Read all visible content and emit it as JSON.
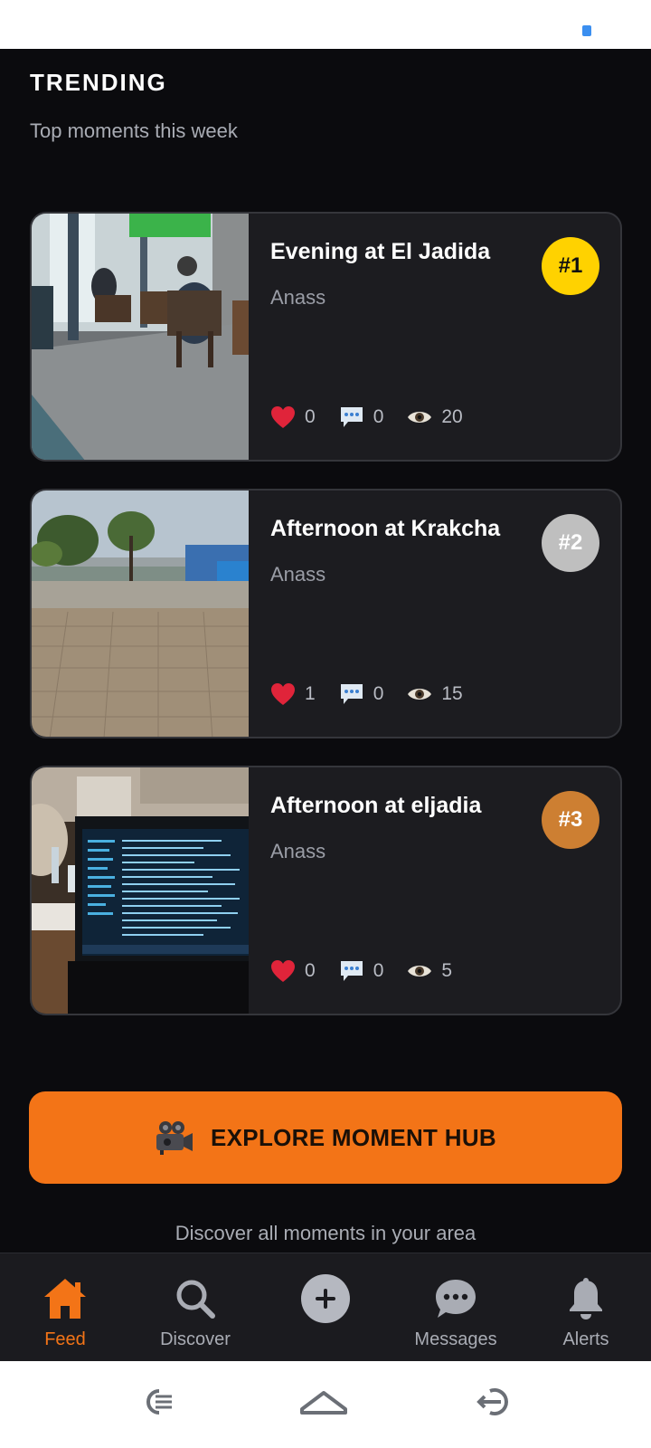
{
  "header": {
    "title": "TRENDING",
    "subtitle": "Top moments this week"
  },
  "moments": [
    {
      "title": "Evening at El Jadida",
      "author": "Anass",
      "rank": "#1",
      "rank_color": "#ffd200",
      "rank_text_color": "#111111",
      "likes": "0",
      "comments": "0",
      "views": "20"
    },
    {
      "title": "Afternoon at Krakcha",
      "author": "Anass",
      "rank": "#2",
      "rank_color": "#bfbfbf",
      "rank_text_color": "#ffffff",
      "likes": "1",
      "comments": "0",
      "views": "15"
    },
    {
      "title": "Afternoon at eljadia",
      "author": "Anass",
      "rank": "#3",
      "rank_color": "#cd7f32",
      "rank_text_color": "#ffffff",
      "likes": "0",
      "comments": "0",
      "views": "5"
    }
  ],
  "explore": {
    "label": "EXPLORE MOMENT HUB",
    "caption": "Discover all moments in your area"
  },
  "bottom_nav": {
    "items": [
      {
        "label": "Feed",
        "icon": "home-icon",
        "active": true
      },
      {
        "label": "Discover",
        "icon": "search-icon",
        "active": false
      },
      {
        "label": "",
        "icon": "add-icon",
        "active": false
      },
      {
        "label": "Messages",
        "icon": "chat-bubble-icon",
        "active": false
      },
      {
        "label": "Alerts",
        "icon": "bell-icon",
        "active": false
      }
    ]
  },
  "colors": {
    "accent": "#f37417",
    "background": "#0b0b0e",
    "card": "#1c1c20"
  }
}
